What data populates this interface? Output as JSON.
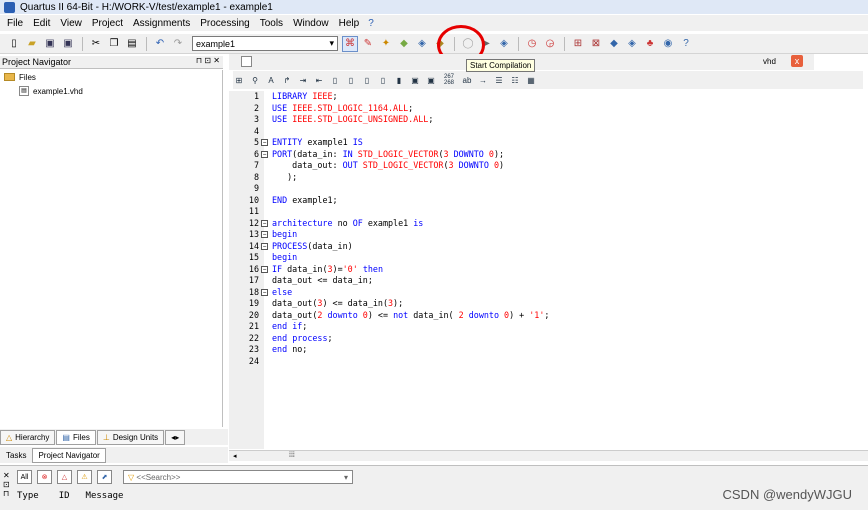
{
  "window": {
    "title": "Quartus II 64-Bit - H:/WORK-V/test/example1 - example1"
  },
  "menu": [
    "File",
    "Edit",
    "View",
    "Project",
    "Assignments",
    "Processing",
    "Tools",
    "Window",
    "Help"
  ],
  "toolbar": {
    "revision_value": "example1",
    "tooltip": "Start Compilation",
    "start_compilation_icon": "play-icon"
  },
  "navigator": {
    "title": "Project Navigator",
    "folder_label": "Files",
    "file": "example1.vhd",
    "tabs": [
      "Hierarchy",
      "Files",
      "Design Units"
    ]
  },
  "tasks_tabs": [
    "Tasks",
    "Project Navigator"
  ],
  "editor": {
    "tab_name": "vhd",
    "close": "x",
    "toolbar_numbers": "267\n268",
    "lines": [
      "LIBRARY IEEE;",
      "USE IEEE.STD_LOGIC_1164.ALL;",
      "USE IEEE.STD_LOGIC_UNSIGNED.ALL;",
      "",
      "ENTITY example1 IS",
      "PORT(data_in: IN STD_LOGIC_VECTOR(3 DOWNTO 0);",
      "    data_out: OUT STD_LOGIC_VECTOR(3 DOWNTO 0)",
      "   );",
      "",
      "END example1;",
      "",
      "architecture no OF example1 is",
      "begin",
      "PROCESS(data_in)",
      "begin",
      "IF data_in(3)='0' then",
      "data_out <= data_in;",
      "else",
      "data_out(3) <= data_in(3);",
      "data_out(2 downto 0) <= not data_in( 2 downto 0) + '1';",
      "end if;",
      "end process;",
      "end no;",
      ""
    ]
  },
  "messages": {
    "filter_all": "All",
    "search_placeholder": "<<Search>>",
    "columns": [
      "Type",
      "ID",
      "Message"
    ]
  },
  "watermark": "CSDN @wendyWJGU"
}
